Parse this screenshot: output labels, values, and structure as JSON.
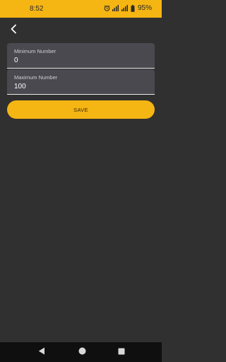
{
  "status_bar": {
    "time": "8:52",
    "battery_percent": "95%",
    "icons": [
      "alarm-icon",
      "signal-icon",
      "signal-icon",
      "battery-icon"
    ]
  },
  "header": {
    "back_icon": "chevron-left-icon"
  },
  "form": {
    "minimum": {
      "label": "Minimum Number",
      "value": "0"
    },
    "maximum": {
      "label": "Maximum Number",
      "value": "100"
    },
    "save_label": "SAVE"
  },
  "nav_bar": {
    "icons": [
      "back-triangle-icon",
      "home-circle-icon",
      "recents-square-icon"
    ]
  },
  "colors": {
    "accent": "#f5b512",
    "background": "#303030",
    "field_background": "#4a4950",
    "nav_background": "#0f0f0f"
  }
}
